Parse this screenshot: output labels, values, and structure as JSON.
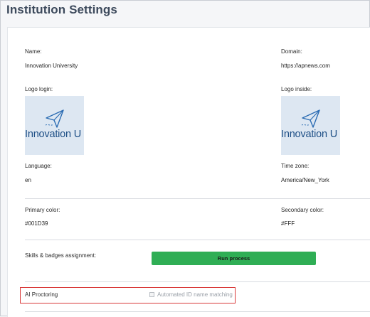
{
  "page_title": "Institution Settings",
  "fields": {
    "name": {
      "label": "Name:",
      "value": "Innovation University"
    },
    "domain": {
      "label": "Domain:",
      "value": "https://apnews.com"
    },
    "logo_login": {
      "label": "Logo login:",
      "logo_text": "Innovation U"
    },
    "logo_inside": {
      "label": "Logo inside:",
      "logo_text": "Innovation U"
    },
    "language": {
      "label": "Language:",
      "value": "en"
    },
    "time_zone": {
      "label": "Time zone:",
      "value": "America/New_York"
    },
    "primary_color": {
      "label": "Primary color:",
      "value": "#001D39"
    },
    "secondary_color": {
      "label": "Secondary color:",
      "value": "#FFF"
    }
  },
  "skills": {
    "label": "Skills & badges assignment:",
    "button_label": "Run process"
  },
  "ai_proctoring": {
    "label": "AI Proctoring",
    "checkbox_label": "Automated ID name matching",
    "checked": false
  },
  "colors": {
    "accent_button": "#2fae55",
    "highlight_border": "#d93a3a",
    "logo_blue": "#1e4f86"
  }
}
